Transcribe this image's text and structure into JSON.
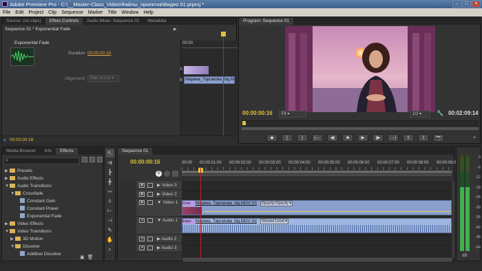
{
  "window": {
    "title": "Adobe Premiere Pro - C:\\__Master-Class_Video\\Файлы_проектов\\Видео 01.prproj *"
  },
  "menu": [
    "File",
    "Edit",
    "Project",
    "Clip",
    "Sequence",
    "Marker",
    "Title",
    "Window",
    "Help"
  ],
  "source_panel": {
    "tabs": [
      "Source: (no clips)",
      "Effect Controls",
      "Audio Mixer: Sequence 01",
      "Metadata"
    ],
    "header": "Sequence 01 * Exponential Fade",
    "effect_name": "Exponential Fade",
    "duration_label": "Duration",
    "duration_value": "00:00:00:10",
    "alignment_label": "Alignment:",
    "alignment_value": "Start at Cut",
    "ruler_start": "00:00",
    "label_a": "A",
    "label_b": "B",
    "clip_b_name": "Марина_Таргакова_big.M",
    "footer_time": "00:00:00:16"
  },
  "program_monitor": {
    "tab": "Program: Sequence 01",
    "timecode": "00:00:00:16",
    "fit": "Fit",
    "resolution": "1/2",
    "duration": "00:02:09:14"
  },
  "effects_panel": {
    "tabs": [
      "Media Browser",
      "Info",
      "Effects"
    ],
    "items": [
      {
        "label": "Presets",
        "level": 0,
        "type": "folder",
        "open": false
      },
      {
        "label": "Audio Effects",
        "level": 0,
        "type": "folder",
        "open": false
      },
      {
        "label": "Audio Transitions",
        "level": 0,
        "type": "folder",
        "open": true
      },
      {
        "label": "Crossfade",
        "level": 1,
        "type": "folder",
        "open": true
      },
      {
        "label": "Constant Gain",
        "level": 2,
        "type": "fx"
      },
      {
        "label": "Constant Power",
        "level": 2,
        "type": "fx"
      },
      {
        "label": "Exponential Fade",
        "level": 2,
        "type": "fx"
      },
      {
        "label": "Video Effects",
        "level": 0,
        "type": "folder",
        "open": false
      },
      {
        "label": "Video Transitions",
        "level": 0,
        "type": "folder",
        "open": true
      },
      {
        "label": "3D Motion",
        "level": 1,
        "type": "folder",
        "open": false
      },
      {
        "label": "Dissolve",
        "level": 1,
        "type": "folder",
        "open": true
      },
      {
        "label": "Additive Dissolve",
        "level": 2,
        "type": "fx"
      }
    ]
  },
  "timeline": {
    "tab": "Sequence 01",
    "timecode": "00:00:00:16",
    "ruler": [
      "00:00",
      "00:00:01:00",
      "00:00:02:00",
      "00:00:03:00",
      "00:00:04:00",
      "00:00:05:00",
      "00:00:06:00",
      "00:00:07:00",
      "00:00:08:00",
      "00:00:09:00"
    ],
    "tracks": [
      "Video 3",
      "Video 2",
      "Video 1",
      "Audio 1",
      "Audio 2",
      "Audio 3"
    ],
    "video_clip": {
      "prefix": "Cros",
      "name": "Марина_Таргакова_big.MOV [V]",
      "property": "Opacity:Opacity"
    },
    "audio_clip": {
      "prefix": "Expo",
      "name": "Марина_Таргакова_big.MOV [A]",
      "property": "Volume:Level"
    }
  },
  "audio_meter": {
    "labels": [
      "0",
      "-6",
      "-12",
      "-18",
      "-24",
      "-30",
      "-36",
      "-42",
      "-48",
      "-54"
    ],
    "bottom": "dB"
  }
}
